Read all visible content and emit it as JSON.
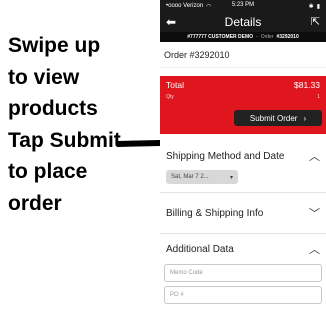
{
  "instructions": {
    "lines": [
      "Swipe up",
      "to view",
      "products",
      "Tap Submit",
      "to place",
      "order"
    ]
  },
  "status_bar": {
    "carrier": "•oooo Verizon",
    "time": "5:23 PM"
  },
  "nav": {
    "title": "Details"
  },
  "sub_bar": {
    "order_ref": "#777777 CUSTOMER DEMO",
    "separator": "-",
    "order_label": "Order",
    "order_id": "#3292010"
  },
  "order": {
    "number_text": "Order #3292010"
  },
  "total": {
    "label": "Total",
    "amount": "$81.33",
    "qty_label": "Qty",
    "qty_value": "1"
  },
  "submit": {
    "label": "Submit Order",
    "chevron": "›"
  },
  "sections": {
    "shipping_title": "Shipping Method and Date",
    "billing_title": "Billing & Shipping Info",
    "additional_title": "Additional Data"
  },
  "shipping_date": {
    "selected": "Sat, Mar 7 2..."
  },
  "fields": {
    "memo_placeholder": "Memo Code",
    "po_placeholder": "PO #"
  },
  "colors": {
    "total_bg": "#e0161f",
    "submit_bg": "#222222",
    "header_bg": "#1a1a1a"
  }
}
